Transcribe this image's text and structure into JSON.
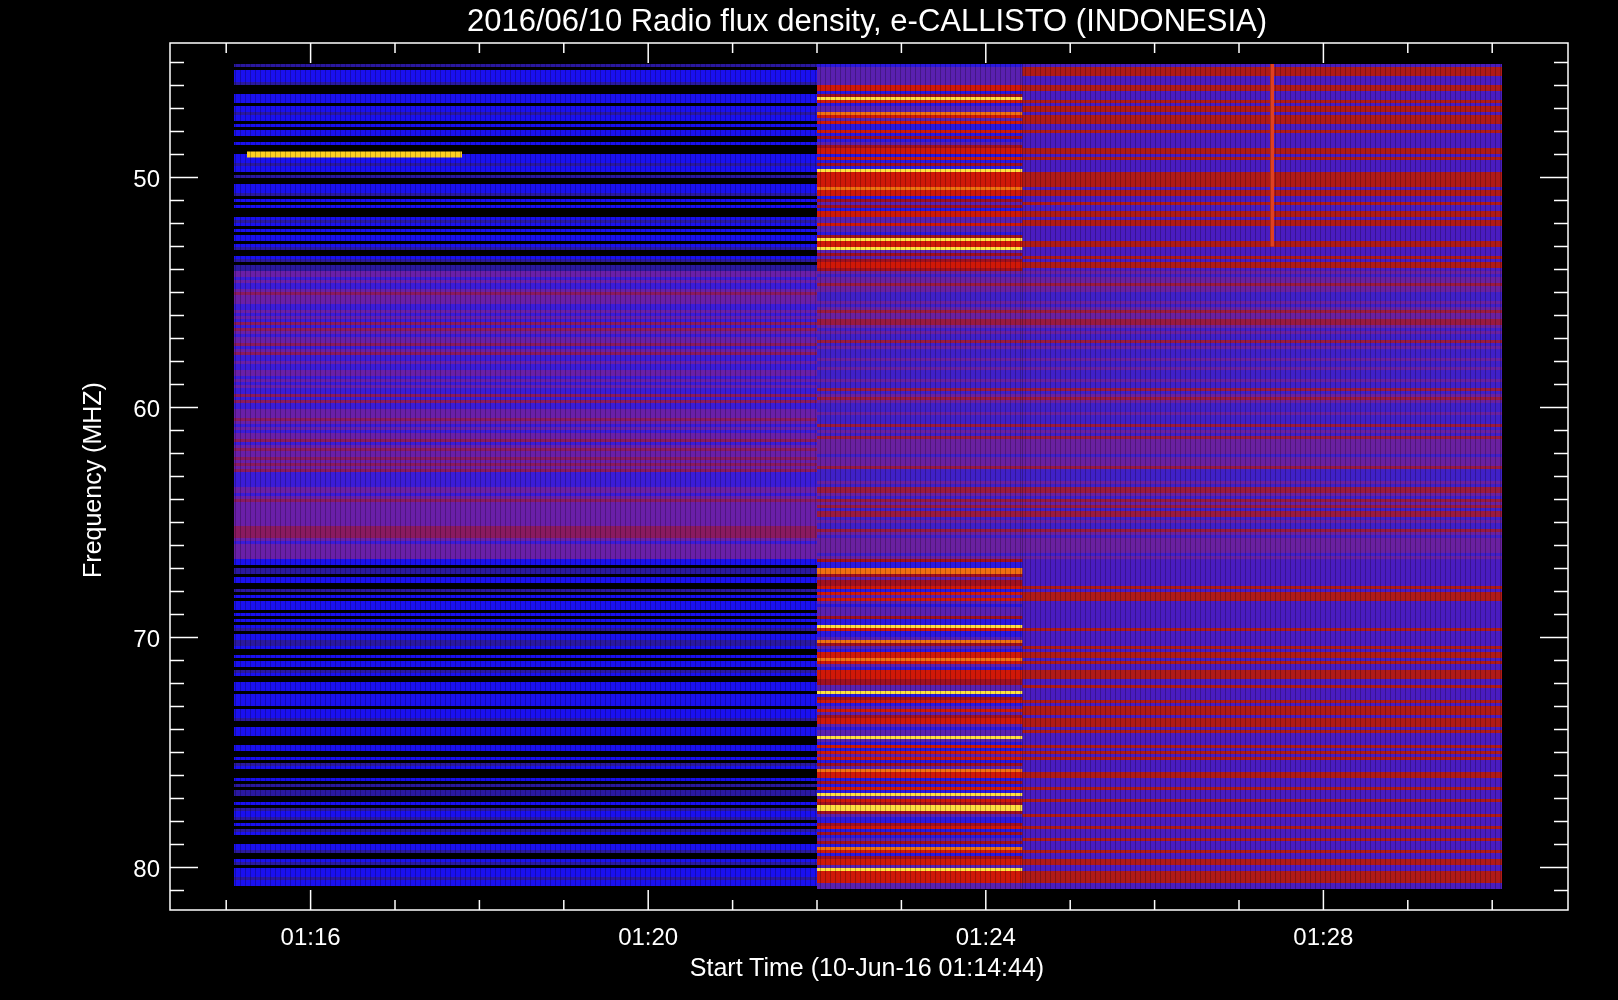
{
  "title": "2016/06/10  Radio flux density, e-CALLISTO (INDONESIA)",
  "plot": {
    "ylabel": "Frequency (MHZ)",
    "xlabel": "Start Time (10-Jun-16 01:14:44)",
    "yticks": [
      "50",
      "60",
      "70",
      "80"
    ],
    "xticks": [
      "01:16",
      "01:20",
      "01:24",
      "01:28"
    ]
  }
}
